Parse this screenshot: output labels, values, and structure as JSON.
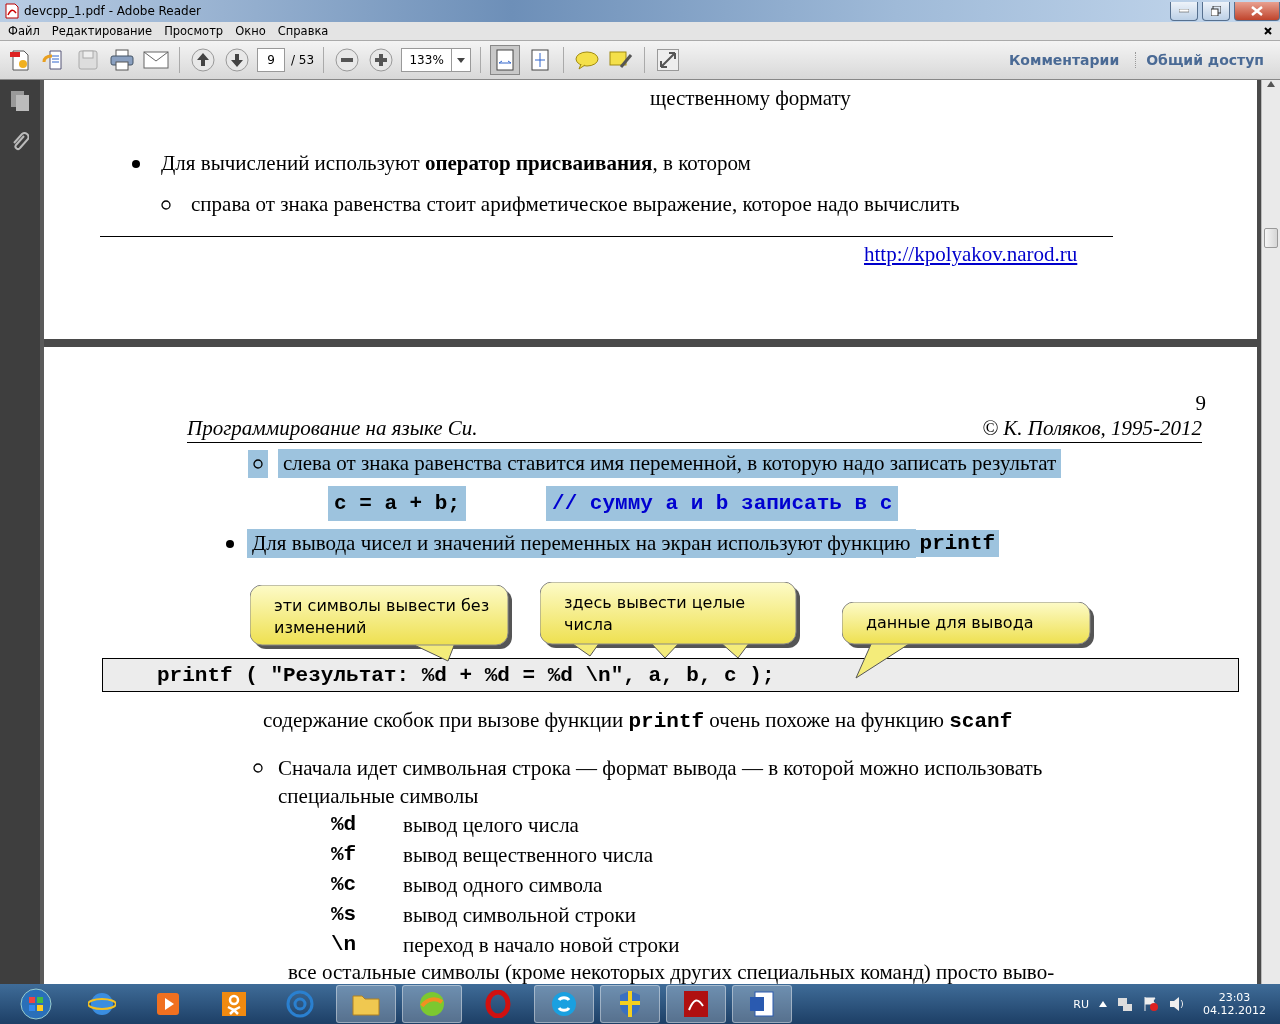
{
  "window": {
    "title": "devcpp_1.pdf - Adobe Reader"
  },
  "menu": [
    "Файл",
    "Редактирование",
    "Просмотр",
    "Окно",
    "Справка"
  ],
  "toolbar": {
    "page": "9",
    "pages": "/ 53",
    "zoom": "133%",
    "links": [
      "Комментарии",
      "Общий доступ"
    ]
  },
  "page_top": {
    "fragment": "щественному формату",
    "bullet": "Для вычислений используют **оператор присваивания**, в котором",
    "sub": "справа от знака равенства стоит арифметическое выражение, которое надо вычислить",
    "link": "http://kpolyakov.narod.ru"
  },
  "page": {
    "number": "9",
    "header_left": "Программирование на языке Си.",
    "header_right": "© К. Поляков, 1995-2012",
    "sub1": {
      "text": "слева от знака равенства ставится имя переменной, в которую надо записать результат",
      "highlighted": true
    },
    "code1": {
      "code": "c = a + b;",
      "comment": "// сумму a и b записать в c",
      "highlighted": true
    },
    "bullet2": {
      "text": "Для вывода чисел и значений переменных на экран используют функцию",
      "code": "printf",
      "highlighted": true
    },
    "callouts": [
      "эти символы вывести без изменений",
      "здесь вывести целые числа",
      "данные для вывода"
    ],
    "code_line": "printf ( \"Результат: %d + %d = %d \\n\", a, b, c );",
    "note": [
      {
        "kind": "text",
        "text": "содержание скобок при вызове функции "
      },
      {
        "kind": "code",
        "text": "printf"
      },
      {
        "kind": "text",
        "text": " очень похоже на функцию "
      },
      {
        "kind": "code",
        "text": "scanf"
      }
    ],
    "sub2": "Сначала идет символьная строка — формат вывода — в которой можно использовать специальные символы",
    "specs": [
      {
        "code": "%d",
        "text": "вывод целого числа"
      },
      {
        "code": "%f",
        "text": "вывод вещественного числа"
      },
      {
        "code": "%c",
        "text": "вывод одного символа"
      },
      {
        "code": "%s",
        "text": "вывод символьной строки"
      },
      {
        "code": "\\n",
        "text": "переход в начало новой строки"
      }
    ],
    "last": "все остальные символы (кроме некоторых других специальных команд) просто выво-"
  },
  "taskbar": {
    "lang": "RU",
    "time": "23:03",
    "date": "04.12.2012"
  }
}
